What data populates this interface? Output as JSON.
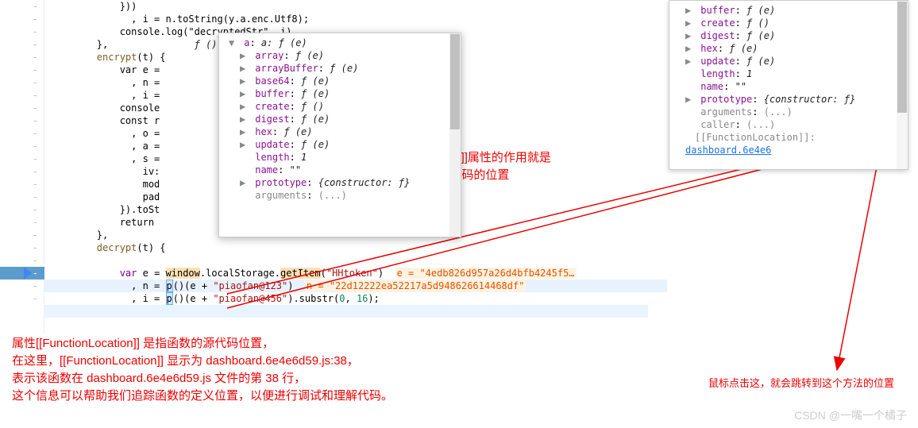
{
  "code": {
    "lines": [
      "            }))",
      "              , i = n.toString(y.a.enc.Utf8);",
      "            console.log(\"decryptedStr\", i)",
      "        },               f ()",
      "        encrypt(t) {",
      "            var e =",
      "              , n =",
      "              , i =",
      "            console",
      "            const r",
      "              , o =",
      "              , a =",
      "              , s =",
      "                iv:",
      "                mod",
      "                pad",
      "            }).toSt",
      "            return",
      "        },",
      "        decrypt(t) {"
    ],
    "line_var_e": "            var e = window.localStorage.getItem(\"HHtoken\")",
    "eval_e": "e = \"4edb826d957a26d4bfb4245f5…",
    "line_var_n": "              , n = p()(e + \"piaofan@123\")",
    "eval_n": "n = \"22d12222ea52217a5d948626614468df\"",
    "line_var_i": "              , i = p()(e + \"piaofan@456\").substr(0, 16);"
  },
  "popup1": {
    "header": "a: ƒ (e)",
    "items": [
      {
        "key": "array",
        "val": "ƒ (e)",
        "arrow": "▶"
      },
      {
        "key": "arrayBuffer",
        "val": "ƒ (e)",
        "arrow": "▶"
      },
      {
        "key": "base64",
        "val": "ƒ (e)",
        "arrow": "▶"
      },
      {
        "key": "buffer",
        "val": "ƒ (e)",
        "arrow": "▶"
      },
      {
        "key": "create",
        "val": "ƒ ()",
        "arrow": "▶"
      },
      {
        "key": "digest",
        "val": "ƒ (e)",
        "arrow": "▶"
      },
      {
        "key": "hex",
        "val": "ƒ (e)",
        "arrow": "▶"
      },
      {
        "key": "update",
        "val": "ƒ (e)",
        "arrow": "▶"
      },
      {
        "key": "length",
        "val": "1",
        "arrow": ""
      },
      {
        "key": "name",
        "val": "\"\"",
        "arrow": ""
      },
      {
        "key": "prototype",
        "val": "{constructor: ƒ}",
        "arrow": "▶"
      },
      {
        "key": "arguments",
        "val": "(...)",
        "arrow": "",
        "internal": true
      }
    ]
  },
  "popup2": {
    "items": [
      {
        "key": "buffer",
        "val": "ƒ (e)",
        "arrow": "▶"
      },
      {
        "key": "create",
        "val": "ƒ ()",
        "arrow": "▶"
      },
      {
        "key": "digest",
        "val": "ƒ (e)",
        "arrow": "▶"
      },
      {
        "key": "hex",
        "val": "ƒ (e)",
        "arrow": "▶"
      },
      {
        "key": "update",
        "val": "ƒ (e)",
        "arrow": "▶"
      },
      {
        "key": "length",
        "val": "1",
        "arrow": ""
      },
      {
        "key": "name",
        "val": "\"\"",
        "arrow": ""
      },
      {
        "key": "prototype",
        "val": "{constructor: ƒ}",
        "arrow": "▶"
      },
      {
        "key": "arguments",
        "val": "(...)",
        "arrow": "",
        "internal": true
      },
      {
        "key": "caller",
        "val": "(...)",
        "arrow": "",
        "internal": true
      }
    ],
    "func_loc_label": "[[FunctionLocation]]: ",
    "func_loc_link": "dashboard.6e4e6"
  },
  "annotations": {
    "center_line1": "[[FunctionLocation]]属性的作用就是",
    "center_line2": "告诉你p()函数源代码的位置",
    "bottom_line1": "属性[[FunctionLocation]] 是指函数的源代码位置，",
    "bottom_line2": "在这里，[[FunctionLocation]] 显示为 dashboard.6e4e6d59.js:38，",
    "bottom_line3": "表示该函数在 dashboard.6e4e6d59.js 文件的第 38 行，",
    "bottom_line4": "这个信息可以帮助我们追踪函数的定义位置，以便进行调试和理解代码。",
    "right_text": "鼠标点击这，就会跳转到这个方法的位置",
    "watermark": "CSDN @一嘴一个橘子"
  }
}
